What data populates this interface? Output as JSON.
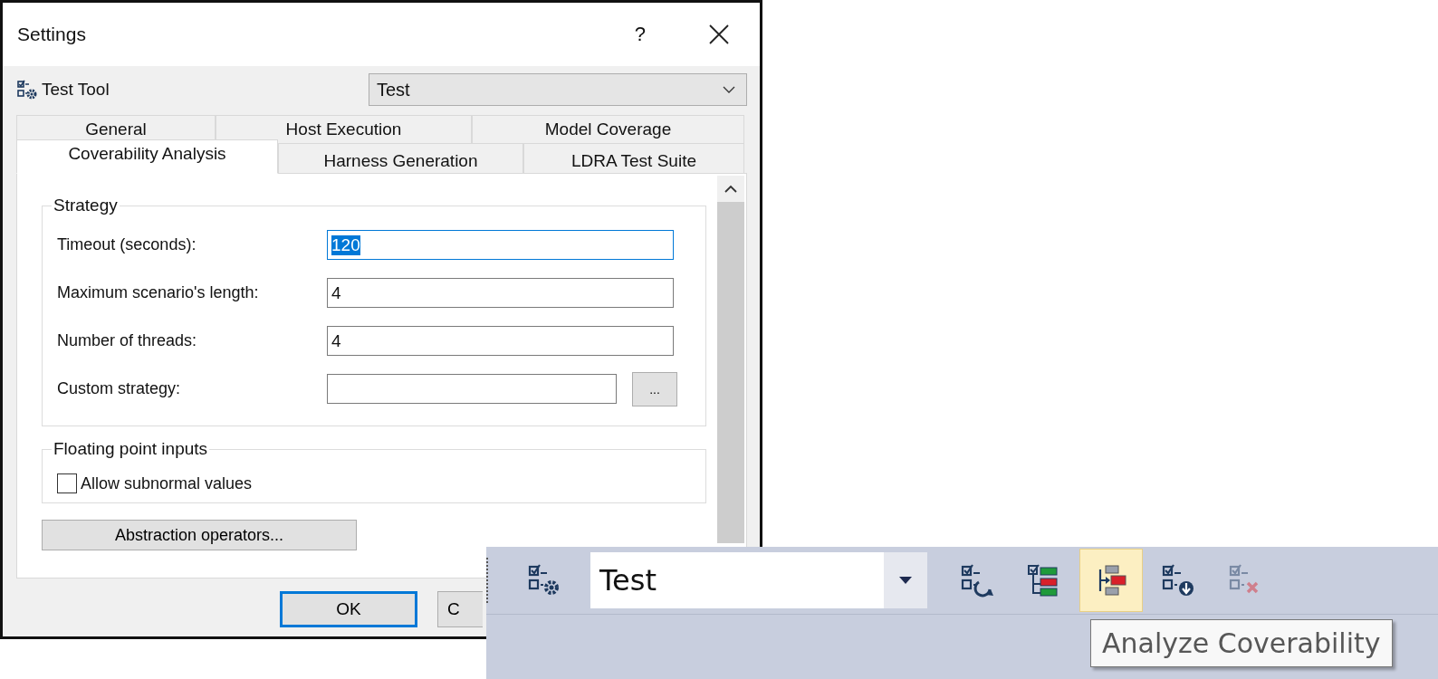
{
  "window": {
    "title": "Settings",
    "help": "?"
  },
  "tool": {
    "label": "Test Tool",
    "value": "Test"
  },
  "tab_rows": [
    {
      "tabs": [
        {
          "label": "General",
          "selected": false
        },
        {
          "label": "Host Execution",
          "selected": false
        },
        {
          "label": "Model Coverage",
          "selected": false
        }
      ]
    },
    {
      "tabs": [
        {
          "label": "Coverability Analysis",
          "selected": true
        },
        {
          "label": "Harness Generation",
          "selected": false
        },
        {
          "label": "LDRA Test Suite",
          "selected": false
        }
      ]
    }
  ],
  "strategy": {
    "title": "Strategy",
    "fields": [
      {
        "kind": "text",
        "label": "Timeout (seconds):",
        "value": "120",
        "focused": true
      },
      {
        "kind": "text",
        "label": "Maximum scenario's length:",
        "value": "4",
        "focused": false
      },
      {
        "kind": "text",
        "label": "Number of threads:",
        "value": "4",
        "focused": false
      },
      {
        "kind": "browse",
        "label": "Custom strategy:",
        "button": "...",
        "focused": false
      }
    ]
  },
  "floating_point": {
    "title": "Floating point inputs",
    "options": [
      {
        "label": "Allow subnormal values",
        "checked": false
      }
    ]
  },
  "abstraction_button": "Abstraction operators...",
  "buttons": [
    {
      "label": "OK",
      "default": true
    },
    {
      "label": "C",
      "default": false
    }
  ],
  "toolbar": {
    "items": [
      {
        "kind": "settings",
        "highlighted": false,
        "disabled": false
      },
      {
        "kind": "combo",
        "value": "Test"
      },
      {
        "kind": "run",
        "highlighted": false,
        "disabled": false
      },
      {
        "kind": "results",
        "highlighted": false,
        "disabled": false
      },
      {
        "kind": "analyze",
        "highlighted": true,
        "disabled": false
      },
      {
        "kind": "import",
        "highlighted": false,
        "disabled": false
      },
      {
        "kind": "clear",
        "highlighted": false,
        "disabled": true
      }
    ],
    "tooltip": "Analyze Coverability"
  }
}
